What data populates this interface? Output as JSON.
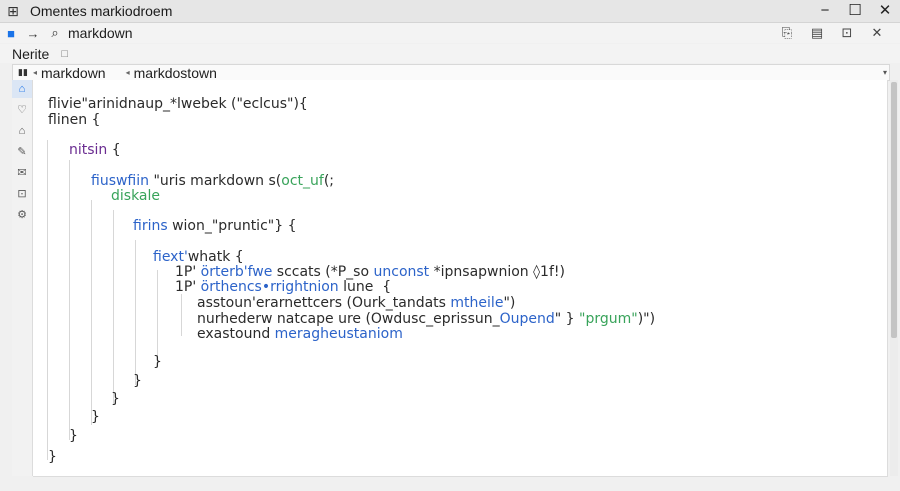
{
  "window": {
    "app_icon": "grid-icon",
    "title": "Omentes markiodroem",
    "minimize_glyph": "−",
    "maximize_glyph": "☐",
    "close_glyph": "✕"
  },
  "addressbar": {
    "back_glyph": "→",
    "search_glyph": "⌕",
    "text": "markdown",
    "tool_1": "⎘",
    "tool_2": "▤",
    "tool_3": "⊡",
    "tool_4": "✕"
  },
  "menubar": {
    "item": "Nerite",
    "icon_glyph": "□"
  },
  "tabs": [
    {
      "label": "markdown"
    },
    {
      "label": "markdostown"
    }
  ],
  "tabbar": {
    "square_glyph": "▮▮",
    "pin_glyph": "◂",
    "dropdown_glyph": "▾"
  },
  "sidebar": {
    "items": [
      {
        "icon": "home-icon",
        "glyph": "⌂"
      },
      {
        "icon": "heart-icon",
        "glyph": "♡"
      },
      {
        "icon": "house-outline-icon",
        "glyph": "⌂"
      },
      {
        "icon": "edit-icon",
        "glyph": "✎"
      },
      {
        "icon": "mail-icon",
        "glyph": "✉"
      },
      {
        "icon": "window-icon",
        "glyph": "⊡"
      },
      {
        "icon": "settings-icon",
        "glyph": "⚙"
      }
    ]
  },
  "code": [
    {
      "plain": "flivie\"arinidnaup_*lwebek (\"eclcus\"){"
    },
    {
      "plain": "flinen {"
    },
    {
      "purple": "nitsin",
      "plain": " {"
    },
    {
      "blue": "fiuswfiin",
      "plain": " \"uris markdown s(",
      "green": "oct_uf",
      "tail": "(;"
    },
    {
      "green": "diskale"
    },
    {
      "blue": "firins",
      "plain": " wion_\"pruntic\"} {"
    },
    {
      "blue": "fiext'",
      "plain": "whatk {"
    },
    {
      "plain": "1P' ",
      "blue": "örterb'fwe",
      "plain2": " sccats (*P_so ",
      "blue2": "unconst",
      "tail": " *ipnsapwnion ◊1f!)"
    },
    {
      "plain": "1P' ",
      "blue": "örthencs•rrightnion",
      "plain2": " lune  {"
    },
    {
      "plain": "asstoun'erarnettcers (Ourk_tandats ",
      "blue": "mtheile",
      "tail": "\")"
    },
    {
      "plain": "nurhederw natcape ure (Owdusc_eprissun_",
      "blue": "Oupend",
      "plain2": "\" } ",
      "green": "\"prgum\"",
      "tail": ")\")"
    },
    {
      "plain": "exastound ",
      "blue": "meragheustaniom"
    },
    {
      "plain": "}"
    },
    {
      "plain": "}"
    },
    {
      "plain": "}"
    },
    {
      "plain": "}"
    },
    {
      "plain": "}"
    },
    {
      "plain": "}"
    }
  ],
  "colors": {
    "keyword_purple": "#6a2c91",
    "string_green": "#38a35a",
    "identifier_blue": "#2c63c9",
    "accent": "#1a73e8"
  }
}
